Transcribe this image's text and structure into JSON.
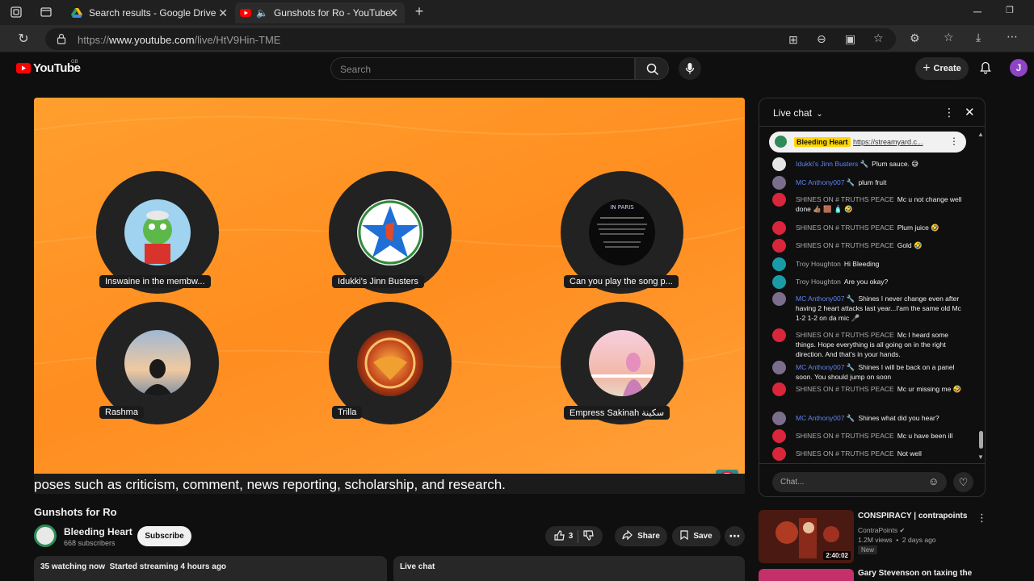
{
  "browser": {
    "tabs": [
      {
        "label": "Search results - Google Drive"
      },
      {
        "label": "Gunshots for Ro - YouTube"
      }
    ],
    "url_prefix": "https://",
    "url_domain": "www.youtube.com",
    "url_path": "/live/HtV9Hin-TME"
  },
  "header": {
    "logo_text": "YouTube",
    "region": "GB",
    "search_placeholder": "Search",
    "create_label": "Create",
    "avatar_letter": "J"
  },
  "video": {
    "participants": [
      {
        "name": "Inswaine in the membw..."
      },
      {
        "name": "Idukki's Jinn Busters"
      },
      {
        "name": "Can you play the song p..."
      },
      {
        "name": "Rashma"
      },
      {
        "name": "Trilla"
      },
      {
        "name": "Empress Sakinah سكينة"
      }
    ],
    "ticker": "poses such as criticism, comment, news reporting, scholarship, and research."
  },
  "meta": {
    "title": "Gunshots for Ro",
    "channel": "Bleeding Heart",
    "subscribers": "668 subscribers",
    "subscribe_label": "Subscribe",
    "likes": "3",
    "share_label": "Share",
    "save_label": "Save",
    "watching": "35 watching now  Started streaming 4 hours ago",
    "live_chat_label": "Live chat"
  },
  "chat": {
    "title": "Live chat",
    "pinned_author": "Bleeding Heart",
    "pinned_link": "https://streamyard.c...",
    "messages": [
      {
        "author": "Idukki's Jinn Busters 🔧",
        "text": "Plum sauce. 😅",
        "mod": true,
        "color": "#e6e6e6"
      },
      {
        "author": "MC Anthony007 🔧",
        "text": "plum fruit",
        "mod": true,
        "color": "#7a6e8c"
      },
      {
        "author": "SHINES ON # TRUTHS PEACE",
        "text": "Mc u not change well done 👍🏽 🟫 🧴 🤣",
        "mod": false,
        "color": "#d9263a"
      },
      {
        "author": "SHINES ON # TRUTHS PEACE",
        "text": "Plum juice 🤣",
        "mod": false,
        "color": "#d9263a"
      },
      {
        "author": "SHINES ON # TRUTHS PEACE",
        "text": "Gold 🤣",
        "mod": false,
        "color": "#d9263a"
      },
      {
        "author": "Troy Houghton",
        "text": "Hi Bleeding",
        "mod": false,
        "color": "#1a9ca8"
      },
      {
        "author": "Troy Houghton",
        "text": "Are you okay?",
        "mod": false,
        "color": "#1a9ca8"
      },
      {
        "author": "MC Anthony007 🔧",
        "text": "Shines I never change even after having 2 heart attacks last year...I'am the same old Mc 1-2 1-2 on da mic 🎤",
        "mod": true,
        "color": "#7a6e8c"
      },
      {
        "author": "SHINES ON # TRUTHS PEACE",
        "text": "Mc I heard some things. Hope everything is all going on in the right direction. And that's in your hands.",
        "mod": false,
        "color": "#d9263a"
      },
      {
        "author": "MC Anthony007 🔧",
        "text": "Shines I will be back on a panel soon. You should jump on soon",
        "mod": true,
        "color": "#7a6e8c"
      },
      {
        "author": "SHINES ON # TRUTHS PEACE",
        "text": "Mc ur missing me 🤣",
        "mod": false,
        "color": "#d9263a"
      },
      {
        "author": "MC Anthony007 🔧",
        "text": "Shines what did you hear?",
        "mod": true,
        "color": "#7a6e8c"
      },
      {
        "author": "SHINES ON # TRUTHS PEACE",
        "text": "Mc u have been ill",
        "mod": false,
        "color": "#d9263a"
      },
      {
        "author": "SHINES ON # TRUTHS PEACE",
        "text": "Not well",
        "mod": false,
        "color": "#d9263a"
      }
    ],
    "input_placeholder": "Chat..."
  },
  "recommended": {
    "title": "CONSPIRACY | contrapoints",
    "channel": "ContraPoints",
    "views": "1.2M views  •  2 days ago",
    "badge": "New",
    "duration": "2:40:02",
    "next_title": "Gary Stevenson on taxing the"
  }
}
